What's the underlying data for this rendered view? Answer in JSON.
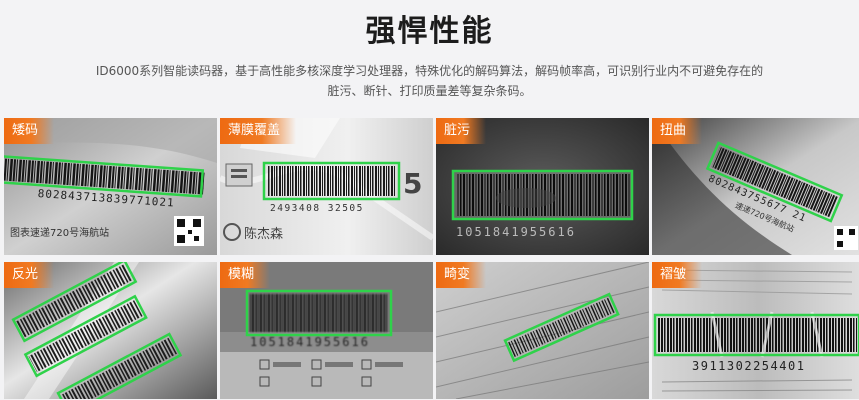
{
  "section": {
    "title": "强悍性能",
    "description_line1": "ID6000系列智能读码器，基于高性能多核深度学习处理器，特殊优化的解码算法，解码帧率高，可识别行业内不可避免存在的",
    "description_line2": "脏污、断针、打印质量差等复杂条码。"
  },
  "cards": [
    {
      "label": "矮码",
      "codes": [
        "802843713839771021"
      ],
      "texts": [
        "图表速递720号海航站"
      ]
    },
    {
      "label": "薄膜覆盖",
      "codes": [
        "2493408 32505"
      ],
      "texts": [
        "陈杰森",
        "5"
      ]
    },
    {
      "label": "脏污",
      "codes": [
        "1051841955616"
      ]
    },
    {
      "label": "扭曲",
      "codes": [
        "802843755677 21"
      ],
      "texts": [
        "速递720号海航站"
      ]
    },
    {
      "label": "反光"
    },
    {
      "label": "模糊",
      "codes": [
        "1051841955616"
      ]
    },
    {
      "label": "畸变"
    },
    {
      "label": "褶皱",
      "codes": [
        "3911302254401"
      ]
    }
  ]
}
